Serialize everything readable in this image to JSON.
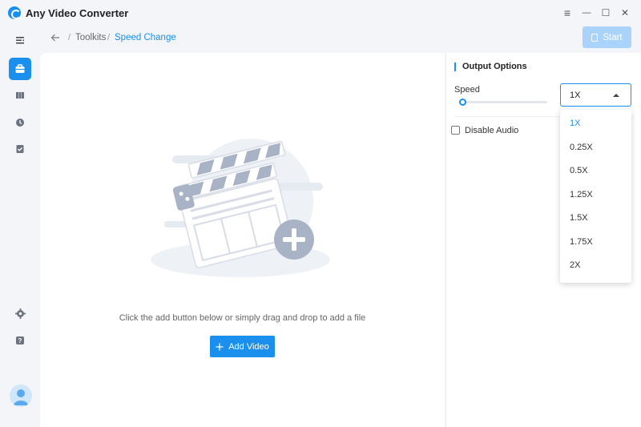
{
  "app": {
    "title": "Any Video Converter"
  },
  "window_controls": {
    "menu": "≡",
    "minimize": "—",
    "maximize": "☐",
    "close": "✕"
  },
  "breadcrumb": {
    "toolkits": "Toolkits",
    "current": "Speed Change"
  },
  "toolbar": {
    "start_label": "Start"
  },
  "main": {
    "hint": "Click the add button below or simply drag and drop to add a file",
    "add_button_label": "Add Video"
  },
  "options": {
    "title": "Output Options",
    "speed_label": "Speed",
    "speed_value": "1X",
    "speed_options": [
      "1X",
      "0.25X",
      "0.5X",
      "1.25X",
      "1.5X",
      "1.75X",
      "2X"
    ],
    "disable_audio_label": "Disable Audio",
    "disable_audio_checked": false
  },
  "colors": {
    "accent": "#1a8fee",
    "start_disabled": "#a9d3fa"
  }
}
